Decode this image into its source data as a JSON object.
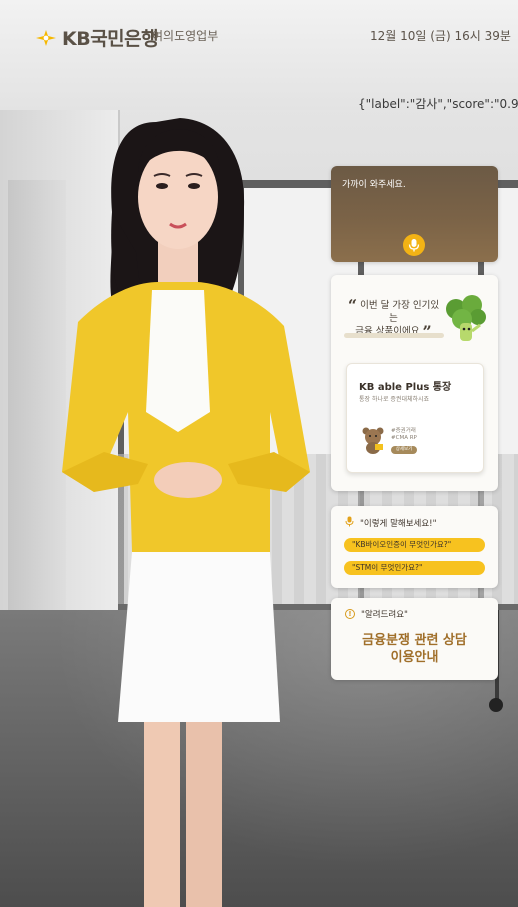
{
  "header": {
    "brand": "KB국민은행",
    "branch": "여의도영업부",
    "datetime": "12월 10일 (금) 16시 39분"
  },
  "overlay_json": "{\"label\":\"감사\",\"score\":\"0.9905\"}",
  "speech_card": {
    "text": "가까이 와주세요.",
    "mic_icon": "microphone-icon"
  },
  "promo_card": {
    "quote_line1": "이번 달 가장 인기있는",
    "quote_line2": "금융 상품이에요",
    "open_quote": "“",
    "close_quote": "”",
    "product_title": "KB able Plus 통장",
    "product_subtitle": "통장 하나로 증권대체하시죠",
    "tag1": "#증권거래",
    "tag2": "#CMA RP",
    "button_label": "상세보기"
  },
  "suggest_card": {
    "header": "\"이렇게 말해보세요!\"",
    "items": [
      "\"KB바이오인증이 무엇인가요?\"",
      "\"STM이 무엇인가요?\""
    ]
  },
  "notice_card": {
    "header": "\"알려드려요\"",
    "body_line1": "금융분쟁 관련 상담",
    "body_line2": "이용안내"
  },
  "colors": {
    "accent": "#f7c21f",
    "brand_brown": "#5a5146",
    "notice_text": "#a06f2a",
    "speech_bg": "#6c5a45"
  }
}
